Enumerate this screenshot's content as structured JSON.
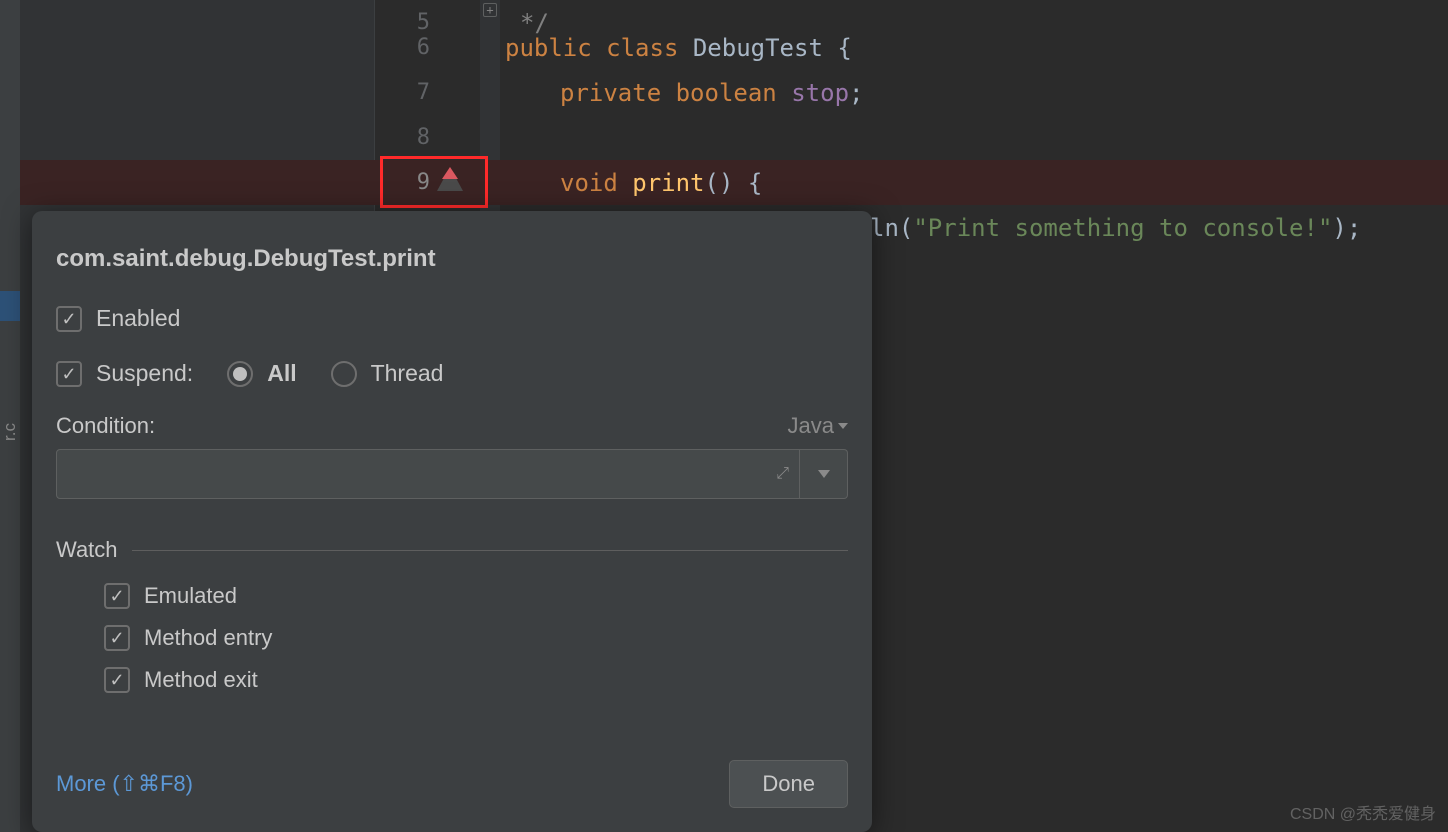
{
  "sidebar": {
    "truncated_text": "r.c"
  },
  "editor": {
    "lines": {
      "5": "*/",
      "6_kw1": "public",
      "6_kw2": "class",
      "6_cls": "DebugTest",
      "6_p": " {",
      "7_kw1": "private",
      "7_kw2": "boolean",
      "7_fld": "stop",
      "7_p": ";",
      "9_kw": "void",
      "9_m": "print",
      "9_p": "() {",
      "10_pre": "ln(",
      "10_str": "\"Print something to console!\"",
      "10_post": ");"
    },
    "line_numbers": [
      "5",
      "6",
      "7",
      "8",
      "9"
    ]
  },
  "popup": {
    "title": "com.saint.debug.DebugTest.print",
    "enabled": "Enabled",
    "suspend": "Suspend:",
    "all": "All",
    "thread": "Thread",
    "condition": "Condition:",
    "language": "Java",
    "watch": "Watch",
    "emulated": "Emulated",
    "method_entry": "Method entry",
    "method_exit": "Method exit",
    "more": "More (⇧⌘F8)",
    "done": "Done"
  },
  "watermark": "CSDN @秃秃爱健身"
}
